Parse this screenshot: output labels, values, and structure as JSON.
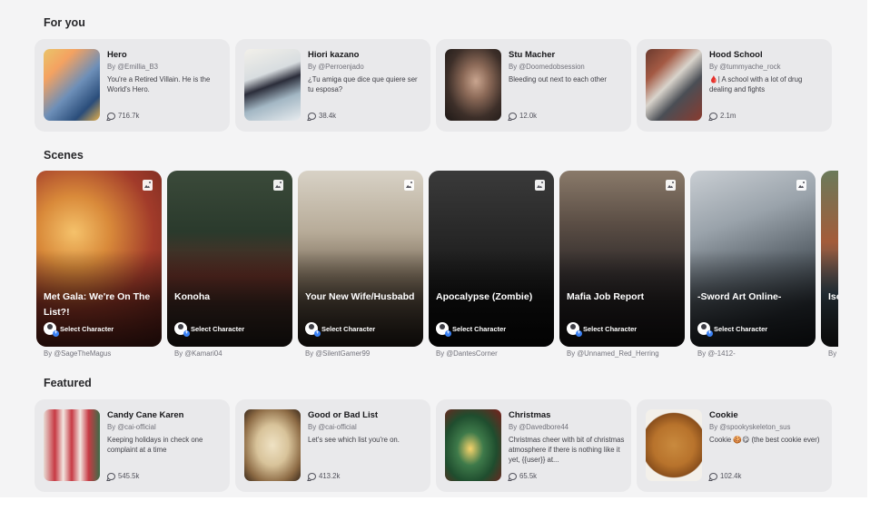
{
  "sections": {
    "for_you": "For you",
    "scenes": "Scenes",
    "featured": "Featured"
  },
  "for_you": [
    {
      "name": "Hero",
      "author": "By @Emillia_B3",
      "description": "You're a Retired Villain. He is the World's Hero.",
      "chats": "716.7k"
    },
    {
      "name": "Hiori kazano",
      "author": "By @Perroenjado",
      "description": "¿Tu amiga que dice que quiere ser tu esposa?",
      "chats": "38.4k"
    },
    {
      "name": "Stu Macher",
      "author": "By @Doomedobsession",
      "description": "Bleeding out next to each other",
      "chats": "12.0k"
    },
    {
      "name": "Hood School",
      "author": "By @tummyache_rock",
      "description": "🩸| A school with a lot of drug dealing and fights",
      "chats": "2.1m"
    }
  ],
  "scenes": [
    {
      "title": "Met Gala: We're On The List?!",
      "author": "By @SageTheMagus",
      "select_label": "Select Character"
    },
    {
      "title": "Konoha",
      "author": "By @Kamari04",
      "select_label": "Select Character"
    },
    {
      "title": "Your New Wife/Husbabd",
      "author": "By @SilentGamer99",
      "select_label": "Select Character"
    },
    {
      "title": "Apocalypse (Zombie)",
      "author": "By @DantesCorner",
      "select_label": "Select Character"
    },
    {
      "title": "Mafia Job Report",
      "author": "By @Unnamed_Red_Herring",
      "select_label": "Select Character"
    },
    {
      "title": "-Sword Art Online-",
      "author": "By @-1412-",
      "select_label": "Select Character"
    },
    {
      "title": "Ise Of",
      "author": "By",
      "select_label": ""
    }
  ],
  "featured": [
    {
      "name": "Candy Cane Karen",
      "author": "By @cai-official",
      "description": "Keeping holidays in check one complaint at a time",
      "chats": "545.5k"
    },
    {
      "name": "Good or Bad List",
      "author": "By @cai-official",
      "description": "Let's see which list you're on.",
      "chats": "413.2k"
    },
    {
      "name": "Christmas",
      "author": "By @Davedbore44",
      "description": "Christmas cheer with bit of christmas atmosphere if there is nothing like it yet, {{user}} at...",
      "chats": "65.5k"
    },
    {
      "name": "Cookie",
      "author": "By @spookyskeleton_sus",
      "description": "Cookie 🍪😋 (the best cookie ever)",
      "chats": "102.4k"
    }
  ]
}
